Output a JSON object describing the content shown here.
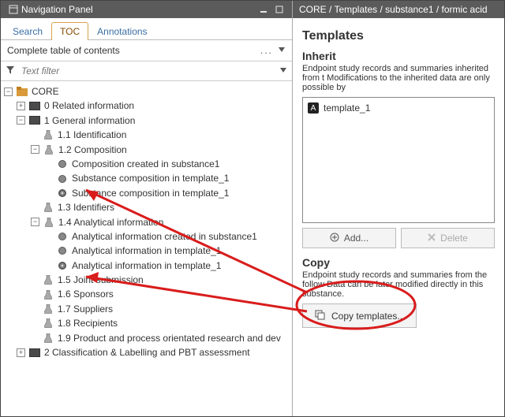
{
  "titlebar": {
    "title": "Navigation Panel"
  },
  "tabs": {
    "search": "Search",
    "toc": "TOC",
    "annotations": "Annotations"
  },
  "subtitle": {
    "text": "Complete table of contents",
    "dots": "..."
  },
  "filter": {
    "placeholder": "Text filter"
  },
  "tree": {
    "root": "CORE",
    "n0": "0 Related information",
    "n1": "1 General information",
    "n1_1": "1.1 Identification",
    "n1_2": "1.2 Composition",
    "n1_2a": "Composition created in substance1",
    "n1_2b": "Substance composition in template_1",
    "n1_2c": "Substance composition in template_1",
    "n1_3": "1.3 Identifiers",
    "n1_4": "1.4 Analytical information",
    "n1_4a": "Analytical information created in substance1",
    "n1_4b": "Analytical information in template_1",
    "n1_4c": "Analytical information in template_1",
    "n1_5": "1.5 Joint submission",
    "n1_6": "1.6 Sponsors",
    "n1_7": "1.7 Suppliers",
    "n1_8": "1.8 Recipients",
    "n1_9": "1.9 Product and process orientated research and dev",
    "n2": "2 Classification & Labelling and PBT assessment"
  },
  "breadcrumb": "CORE / Templates / substance1 / formic acid",
  "right": {
    "heading": "Templates",
    "inherit_heading": "Inherit",
    "inherit_desc": "Endpoint study records and summaries inherited from t Modifications to the inherited data are only possible by",
    "template_item": "template_1",
    "add_btn": "Add...",
    "delete_btn": "Delete",
    "copy_heading": "Copy",
    "copy_desc": "Endpoint study records and summaries from the follow Data can be later modified directly in this substance.",
    "copy_btn": "Copy templates..."
  }
}
